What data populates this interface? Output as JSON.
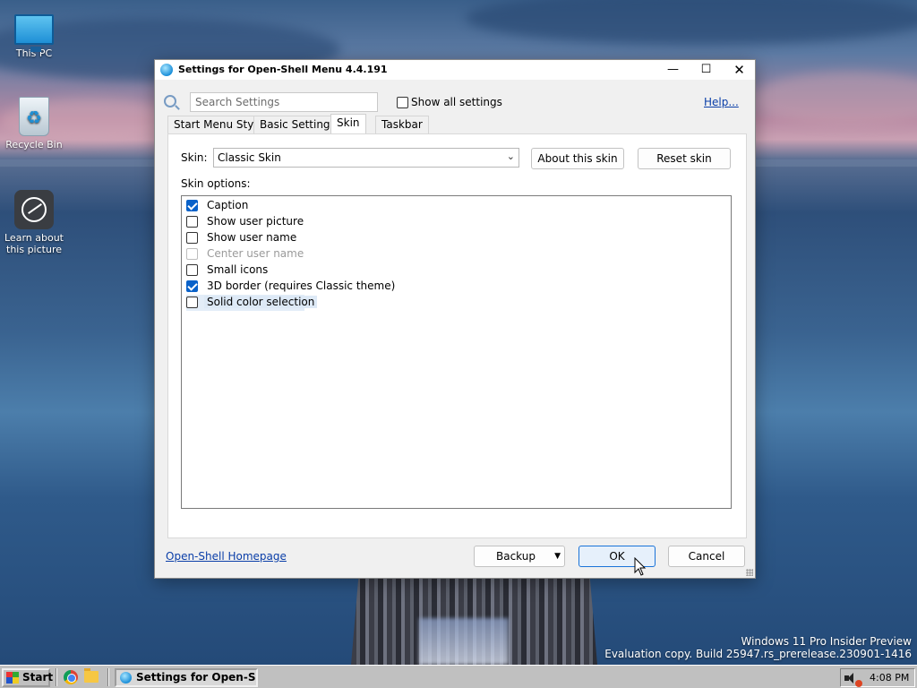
{
  "desktop": {
    "icons": [
      {
        "label": "This PC"
      },
      {
        "label": "Recycle Bin"
      },
      {
        "label": "Learn about this picture"
      }
    ],
    "watermark": {
      "line1": "Windows 11 Pro Insider Preview",
      "line2": "Evaluation copy. Build 25947.rs_prerelease.230901-1416"
    }
  },
  "dialog": {
    "title": "Settings for Open-Shell Menu 4.4.191",
    "search": {
      "placeholder": "Search Settings",
      "value": ""
    },
    "show_all_label": "Show all settings",
    "show_all_checked": false,
    "help_label": "Help...",
    "tabs": [
      {
        "label": "Start Menu Style",
        "active": false
      },
      {
        "label": "Basic Settings",
        "active": false
      },
      {
        "label": "Skin",
        "active": true
      },
      {
        "label": "Taskbar",
        "active": false
      }
    ],
    "skin": {
      "label": "Skin:",
      "selected": "Classic Skin",
      "about_button": "About this skin",
      "reset_button": "Reset skin",
      "options_label": "Skin options:",
      "options": [
        {
          "label": "Caption",
          "checked": true,
          "enabled": true
        },
        {
          "label": "Show user picture",
          "checked": false,
          "enabled": true
        },
        {
          "label": "Show user name",
          "checked": false,
          "enabled": true
        },
        {
          "label": "Center user name",
          "checked": false,
          "enabled": false
        },
        {
          "label": "Small icons",
          "checked": false,
          "enabled": true
        },
        {
          "label": "3D border (requires Classic theme)",
          "checked": true,
          "enabled": true
        },
        {
          "label": "Solid color selection",
          "checked": false,
          "enabled": true,
          "focused": true
        }
      ]
    },
    "footer": {
      "homepage_link": "Open-Shell Homepage",
      "backup_button": "Backup",
      "ok_button": "OK",
      "cancel_button": "Cancel"
    }
  },
  "taskbar": {
    "start_label": "Start",
    "task_label": "Settings for Open-She...",
    "clock": "4:08 PM"
  }
}
